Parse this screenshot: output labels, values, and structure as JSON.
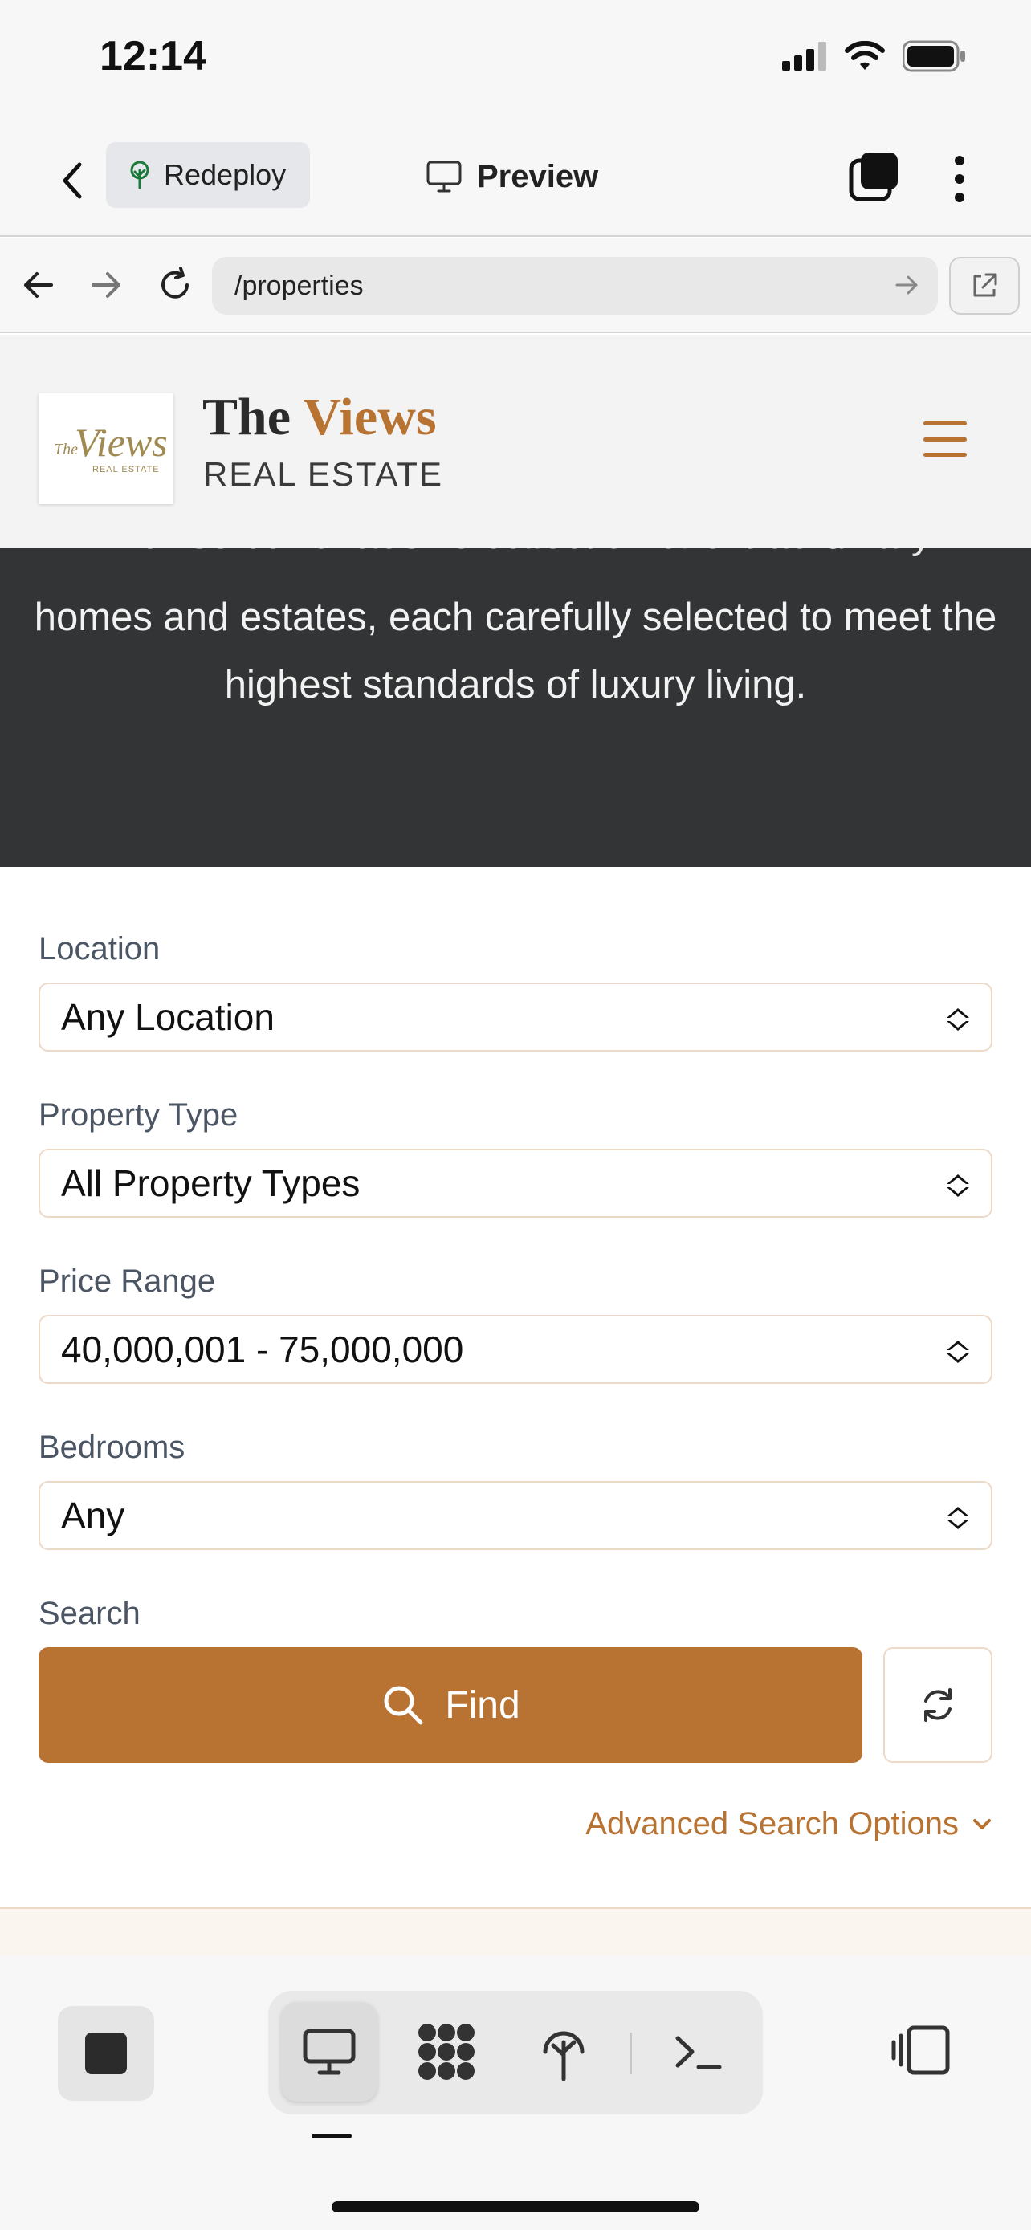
{
  "status": {
    "time": "12:14"
  },
  "appbar": {
    "redeploy_label": "Redeploy",
    "preview_label": "Preview"
  },
  "browser": {
    "url": "/properties"
  },
  "site": {
    "brand_the": "The",
    "brand_views": "Views",
    "brand_sub": "REAL ESTATE",
    "logo_script": "Views",
    "logo_small_the": "The",
    "logo_small": "REAL ESTATE"
  },
  "hero": {
    "text_cut": "Browse our exclusive collection of extraordinary",
    "text": "homes and estates, each carefully selected to meet the highest standards of luxury living."
  },
  "search": {
    "location_label": "Location",
    "location_value": "Any Location",
    "type_label": "Property Type",
    "type_value": "All Property Types",
    "price_label": "Price Range",
    "price_value": "40,000,001 - 75,000,000",
    "bedrooms_label": "Bedrooms",
    "bedrooms_value": "Any",
    "search_label": "Search",
    "find_label": "Find",
    "advanced_label": "Advanced Search Options"
  },
  "colors": {
    "accent": "#b87333",
    "hero_bg": "#333435",
    "field_border": "#ecd9c6"
  }
}
